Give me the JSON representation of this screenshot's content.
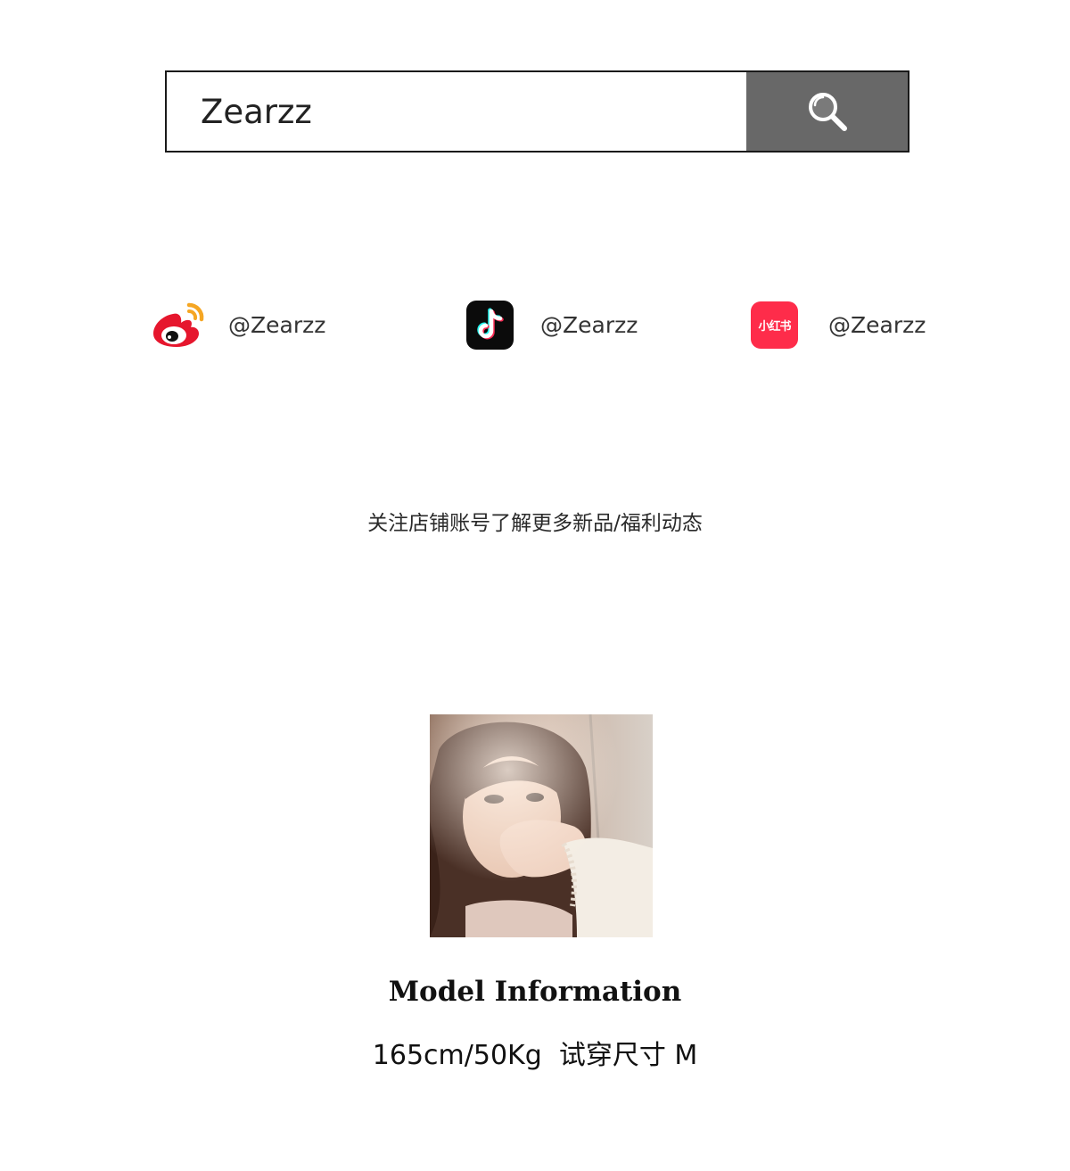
{
  "search": {
    "value": "Zearzz",
    "button_icon": "search-icon",
    "button_color": "#686868"
  },
  "socials": [
    {
      "platform_icon": "weibo-icon",
      "handle": "@Zearzz"
    },
    {
      "platform_icon": "douyin-icon",
      "handle": "@Zearzz"
    },
    {
      "platform_icon": "xiaohongshu-icon",
      "icon_text": "小红书",
      "handle": "@Zearzz",
      "color": "#fe2c4a"
    }
  ],
  "follow_note": "关注店铺账号了解更多新品/福利动态",
  "model": {
    "heading": "Model Information",
    "stats": "165cm/50Kg  试穿尺寸 M"
  }
}
